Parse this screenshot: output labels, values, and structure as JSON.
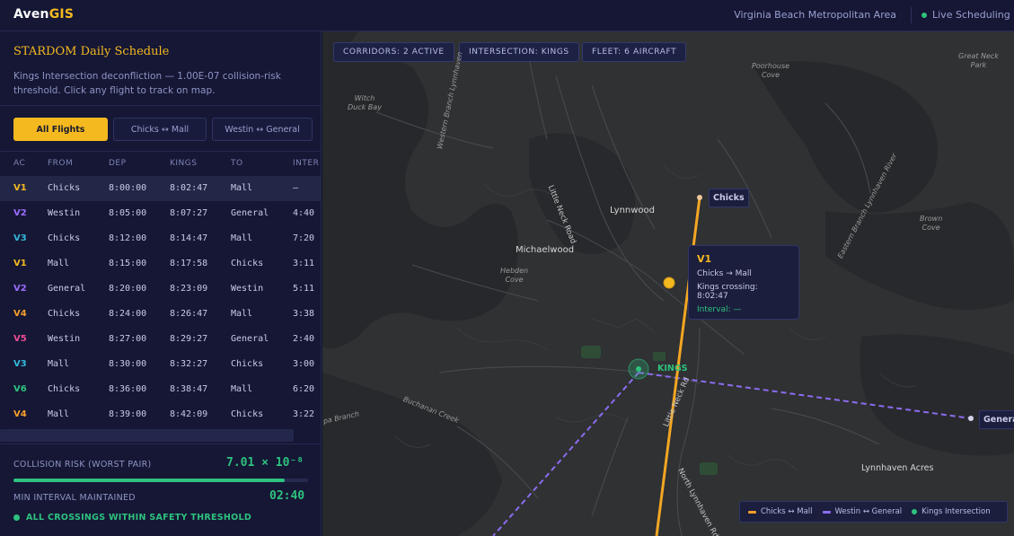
{
  "app": {
    "brand_main": "Aven",
    "brand_accent": "GIS",
    "region": "Virginia Beach Metropolitan Area",
    "live_label": "Live Scheduling"
  },
  "panel": {
    "title": "STARDOM Daily Schedule",
    "description": "Kings Intersection deconfliction — 1.00E-07 collision-risk threshold. Click any flight to track on map.",
    "filters": [
      {
        "label": "All Flights",
        "active": true
      },
      {
        "label": "Chicks ↔ Mall",
        "active": false
      },
      {
        "label": "Westin ↔ General",
        "active": false
      }
    ],
    "columns": [
      "AC",
      "FROM",
      "DEP",
      "KINGS",
      "TO",
      "INTER"
    ],
    "rows": [
      {
        "ac": "V1",
        "color": "#f4b91f",
        "from": "Chicks",
        "dep": "8:00:00",
        "kings": "8:02:47",
        "to": "Mall",
        "inter": "—"
      },
      {
        "ac": "V2",
        "color": "#9b6cff",
        "from": "Westin",
        "dep": "8:05:00",
        "kings": "8:07:27",
        "to": "General",
        "inter": "4:40"
      },
      {
        "ac": "V3",
        "color": "#35b7d8",
        "from": "Chicks",
        "dep": "8:12:00",
        "kings": "8:14:47",
        "to": "Mall",
        "inter": "7:20"
      },
      {
        "ac": "V1",
        "color": "#f4b91f",
        "from": "Mall",
        "dep": "8:15:00",
        "kings": "8:17:58",
        "to": "Chicks",
        "inter": "3:11"
      },
      {
        "ac": "V2",
        "color": "#9b6cff",
        "from": "General",
        "dep": "8:20:00",
        "kings": "8:23:09",
        "to": "Westin",
        "inter": "5:11"
      },
      {
        "ac": "V4",
        "color": "#f59f2a",
        "from": "Chicks",
        "dep": "8:24:00",
        "kings": "8:26:47",
        "to": "Mall",
        "inter": "3:38"
      },
      {
        "ac": "V5",
        "color": "#ec4d92",
        "from": "Westin",
        "dep": "8:27:00",
        "kings": "8:29:27",
        "to": "General",
        "inter": "2:40"
      },
      {
        "ac": "V3",
        "color": "#35b7d8",
        "from": "Mall",
        "dep": "8:30:00",
        "kings": "8:32:27",
        "to": "Chicks",
        "inter": "3:00"
      },
      {
        "ac": "V6",
        "color": "#2ec27e",
        "from": "Chicks",
        "dep": "8:36:00",
        "kings": "8:38:47",
        "to": "Mall",
        "inter": "6:20"
      },
      {
        "ac": "V4",
        "color": "#f59f2a",
        "from": "Mall",
        "dep": "8:39:00",
        "kings": "8:42:09",
        "to": "Chicks",
        "inter": "3:22"
      }
    ],
    "risk_label": "COLLISION RISK (WORST PAIR)",
    "risk_value": "7.01 × 10⁻⁸",
    "risk_fraction": 0.92,
    "interval_label": "MIN INTERVAL MAINTAINED",
    "interval_value": "02:40",
    "status": "ALL CROSSINGS WITHIN SAFETY THRESHOLD"
  },
  "map": {
    "badges": [
      "CORRIDORS: 2 ACTIVE",
      "INTERSECTION: KINGS",
      "FLEET: 6 AIRCRAFT"
    ],
    "tooltip": {
      "ac": "V1",
      "route": "Chicks → Mall",
      "crossing": "Kings crossing: 8:02:47",
      "interval": "Interval: —"
    },
    "pins": {
      "chicks": "Chicks",
      "general": "Genera"
    },
    "kings_label": "KINGS",
    "places": {
      "lynnwood": "Lynnwood",
      "michaelwood": "Michaelwood",
      "lynnhaven_acres": "Lynnhaven Acres",
      "little_neck_road": "Little Neck Road",
      "little_neck_rd": "Little Neck Rd",
      "north_lynnhaven": "North Lynnhaven Rd",
      "western_branch": "Western Branch Lynnhaven",
      "eastern_branch": "Eastern Branch Lynnhaven River",
      "buchanan_creek": "Buchanan Creek",
      "pa_branch": "pa Branch",
      "poorhouse_cove": "Poorhouse\nCove",
      "great_neck_park": "Great Neck\nPark",
      "witch_duck_bay": "Witch\nDuck Bay",
      "hebden_cove": "Hebden\nCove",
      "brown_cove": "Brown\nCove"
    },
    "legend": [
      {
        "label": "Chicks ↔ Mall",
        "color": "#f59f2a",
        "kind": "line"
      },
      {
        "label": "Westin ↔ General",
        "color": "#8c6cf0",
        "kind": "line"
      },
      {
        "label": "Kings Intersection",
        "color": "#2ec27e",
        "kind": "dot"
      }
    ]
  }
}
